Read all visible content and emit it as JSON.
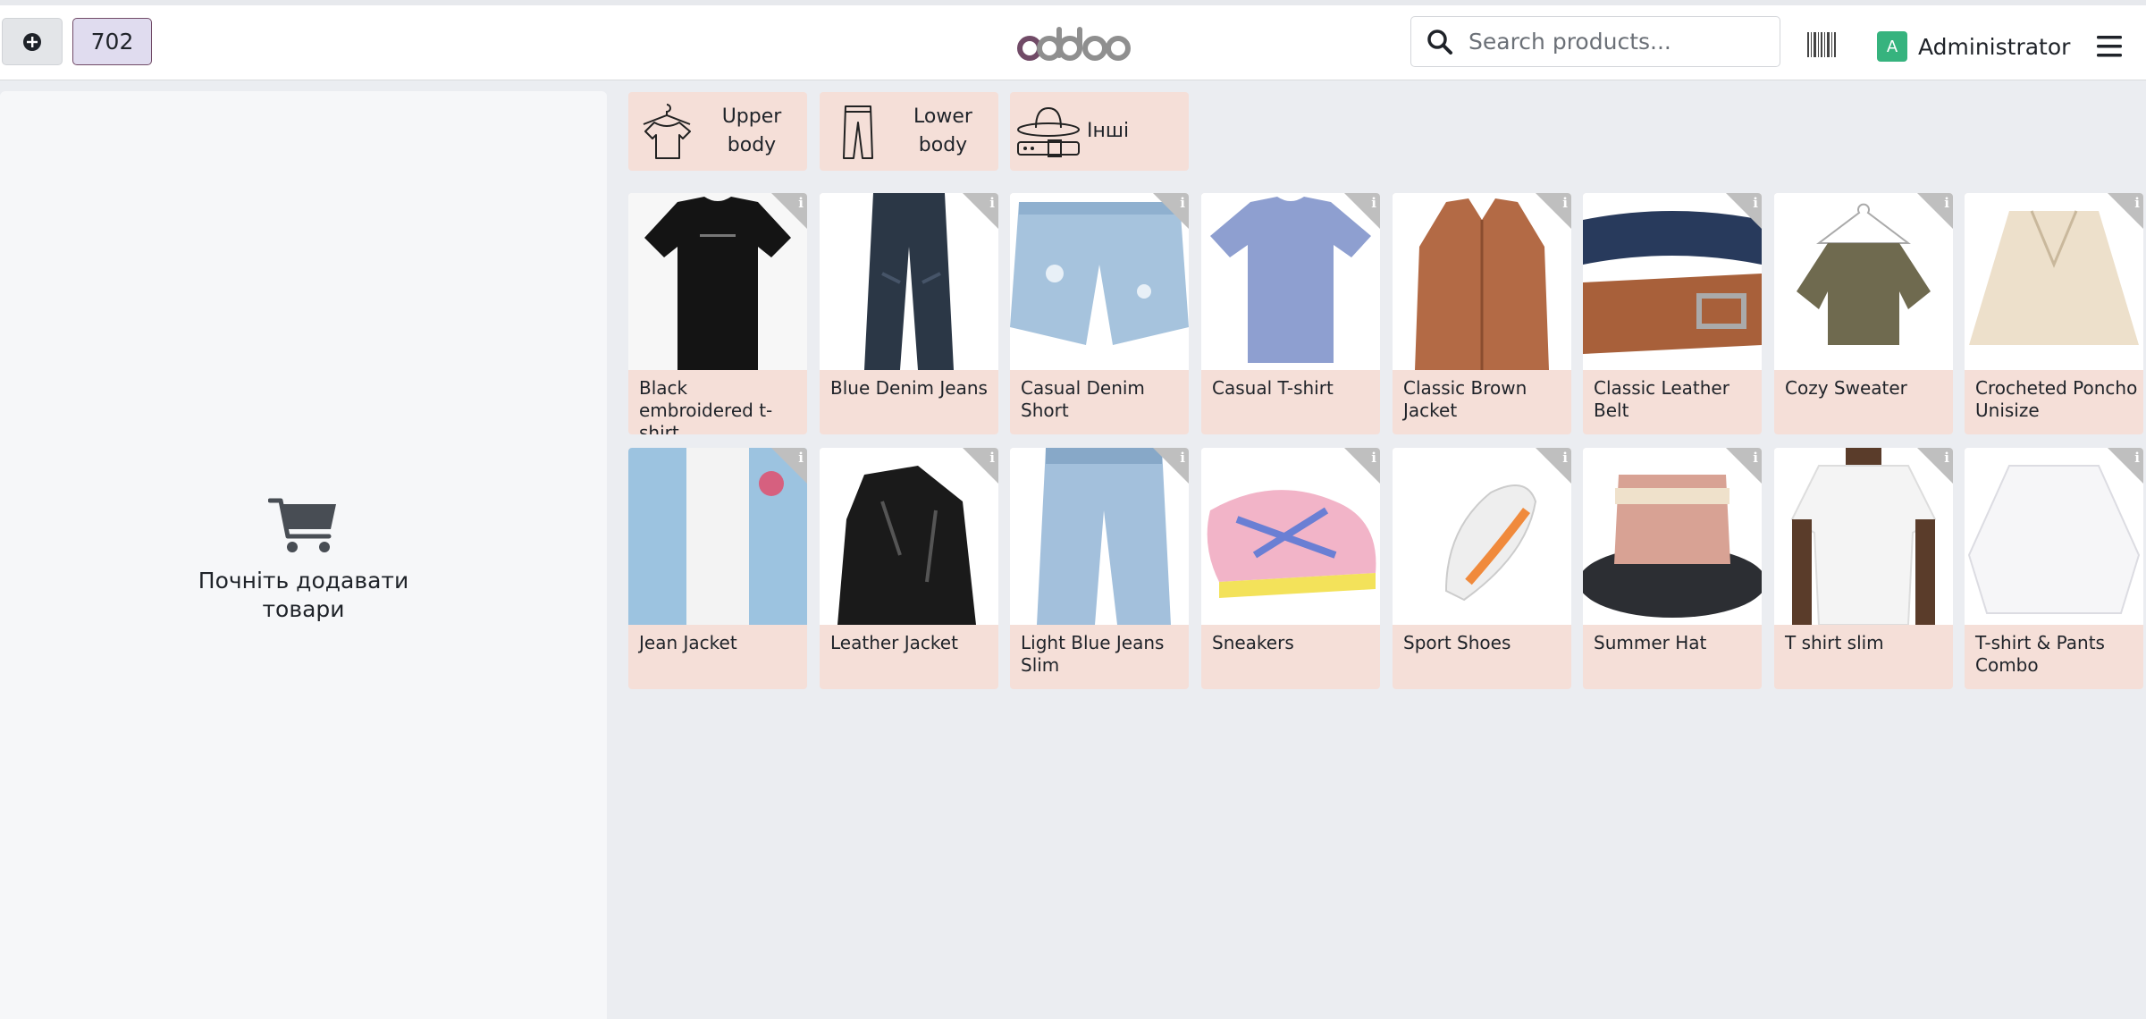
{
  "header": {
    "order_number": "702",
    "logo_text": "odoo",
    "search_placeholder": "Search products...",
    "user_initial": "A",
    "user_name": "Administrator"
  },
  "order_panel": {
    "empty_message": "Почніть додавати товари"
  },
  "categories": [
    {
      "label": "Upper body",
      "icon": "tshirt-hanger-icon"
    },
    {
      "label": "Lower body",
      "icon": "pants-icon"
    },
    {
      "label": "Інші",
      "icon": "hat-belt-icon"
    }
  ],
  "products": [
    {
      "name": "Black embroidered t-shirt"
    },
    {
      "name": "Blue Denim Jeans"
    },
    {
      "name": "Casual Denim Short"
    },
    {
      "name": "Casual T-shirt"
    },
    {
      "name": "Classic Brown Jacket"
    },
    {
      "name": "Classic Leather Belt"
    },
    {
      "name": "Cozy Sweater"
    },
    {
      "name": "Crocheted Poncho Unisize"
    },
    {
      "name": "Jean Jacket"
    },
    {
      "name": "Leather Jacket"
    },
    {
      "name": "Light Blue Jeans Slim"
    },
    {
      "name": "Sneakers"
    },
    {
      "name": "Sport Shoes"
    },
    {
      "name": "Summer Hat"
    },
    {
      "name": "T shirt slim"
    },
    {
      "name": "T-shirt & Pants Combo"
    }
  ],
  "colors": {
    "brand": "#714b67",
    "card_bg": "#f5dfd8",
    "avatar_bg": "#36b37e"
  }
}
